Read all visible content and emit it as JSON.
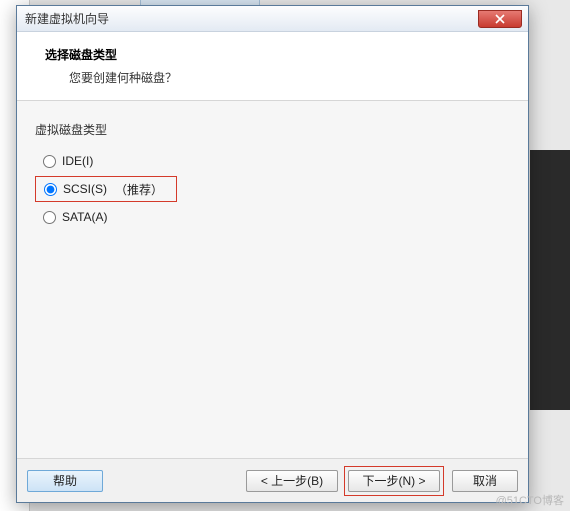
{
  "dialog": {
    "title": "新建虚拟机向导",
    "heading": "选择磁盘类型",
    "subheading": "您要创建何种磁盘？",
    "group_label": "虚拟磁盘类型",
    "options": {
      "ide": "IDE(I)",
      "scsi": "SCSI(S)",
      "recommended_suffix": "（推荐）",
      "sata": "SATA(A)"
    },
    "selected": "scsi",
    "buttons": {
      "help": "帮助",
      "back": "< 上一步(B)",
      "next": "下一步(N) >",
      "cancel": "取消"
    }
  },
  "watermark": "@51CTO博客"
}
